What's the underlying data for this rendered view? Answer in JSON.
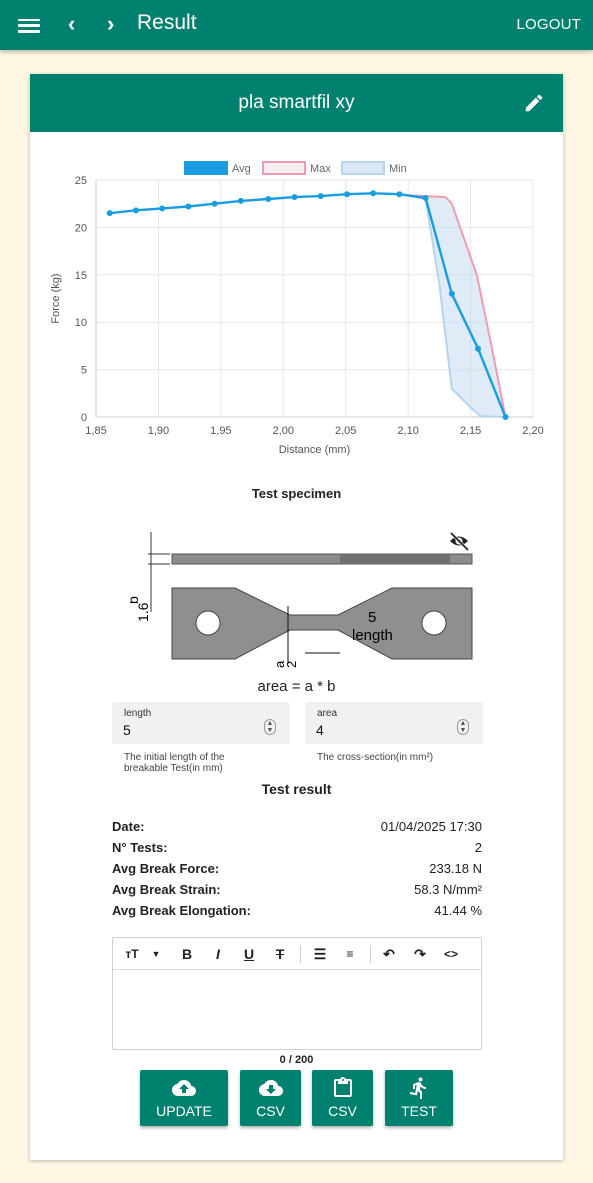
{
  "topbar": {
    "title": "Result",
    "logout": "LOGOUT",
    "menu_icon": "menu-icon",
    "back_icon": "chevron-left-icon",
    "forward_icon": "chevron-right-icon"
  },
  "card": {
    "title": "pla smartfil xy",
    "edit_icon": "pencil-icon"
  },
  "chart_data": {
    "type": "line",
    "xlabel": "Distance (mm)",
    "ylabel": "Force (kg)",
    "xlim": [
      1.85,
      2.2
    ],
    "ylim": [
      0,
      25
    ],
    "xticks": [
      "1,85",
      "1,90",
      "1,95",
      "2,00",
      "2,05",
      "2,10",
      "2,15",
      "2,20"
    ],
    "yticks": [
      "0",
      "5",
      "10",
      "15",
      "20",
      "25"
    ],
    "legend_position": "top",
    "series": [
      {
        "name": "Avg",
        "color": "#1a9de0",
        "points": [
          [
            1.861,
            21.5
          ],
          [
            1.882,
            21.8
          ],
          [
            1.903,
            22.0
          ],
          [
            1.924,
            22.2
          ],
          [
            1.945,
            22.5
          ],
          [
            1.966,
            22.8
          ],
          [
            1.988,
            23.0
          ],
          [
            2.009,
            23.2
          ],
          [
            2.03,
            23.3
          ],
          [
            2.051,
            23.5
          ],
          [
            2.072,
            23.6
          ],
          [
            2.093,
            23.5
          ],
          [
            2.114,
            23.1
          ],
          [
            2.135,
            13.0
          ],
          [
            2.156,
            7.2
          ],
          [
            2.178,
            0.0
          ]
        ]
      },
      {
        "name": "Max",
        "color": "#f29bb0",
        "points": [
          [
            2.1,
            23.4
          ],
          [
            2.13,
            23.2
          ],
          [
            2.135,
            22.5
          ],
          [
            2.155,
            15.0
          ],
          [
            2.166,
            8.0
          ],
          [
            2.178,
            0.0
          ]
        ]
      },
      {
        "name": "Min",
        "color": "#b7d4ee",
        "points": [
          [
            2.1,
            23.4
          ],
          [
            2.114,
            23.0
          ],
          [
            2.125,
            14.0
          ],
          [
            2.135,
            3.0
          ],
          [
            2.15,
            1.0
          ],
          [
            2.158,
            0.1
          ],
          [
            2.178,
            0.0
          ]
        ]
      }
    ]
  },
  "specimen": {
    "title": "Test specimen",
    "dims": {
      "b": "b",
      "b_value": "1.6",
      "a": "a",
      "a_value": "2",
      "length_value": "5",
      "length_label": "length"
    },
    "hide_icon": "eye-off-icon",
    "formula": "area = a * b"
  },
  "inputs": [
    {
      "label": "length",
      "value": "5",
      "hint": "The initial length of the breakable Test(in mm)"
    },
    {
      "label": "area",
      "value": "4",
      "hint": "The cross-section(in mm²)"
    }
  ],
  "result": {
    "title": "Test result",
    "rows": [
      {
        "key": "Date:",
        "value": "01/04/2025 17:30"
      },
      {
        "key": "N° Tests:",
        "value": "2"
      },
      {
        "key": "Avg Break Force:",
        "value": "233.18 N"
      },
      {
        "key": "Avg Break Strain:",
        "value": "58.3 N/mm²"
      },
      {
        "key": "Avg Break Elongation:",
        "value": "41.44 %"
      }
    ]
  },
  "editor": {
    "tools": [
      "text-size-icon",
      "dropdown-icon",
      "bold-icon",
      "italic-icon",
      "underline-icon",
      "clear-format-icon",
      "bullet-list-icon",
      "numbered-list-icon",
      "undo-icon",
      "redo-icon",
      "code-icon"
    ],
    "counter": "0 / 200"
  },
  "buttons": [
    {
      "label": "UPDATE",
      "icon": "cloud-upload-icon"
    },
    {
      "label": "CSV",
      "icon": "cloud-download-icon"
    },
    {
      "label": "CSV",
      "icon": "clipboard-icon"
    },
    {
      "label": "TEST",
      "icon": "run-icon"
    }
  ],
  "colors": {
    "primary": "#00806f",
    "background": "#fdf6e3"
  }
}
